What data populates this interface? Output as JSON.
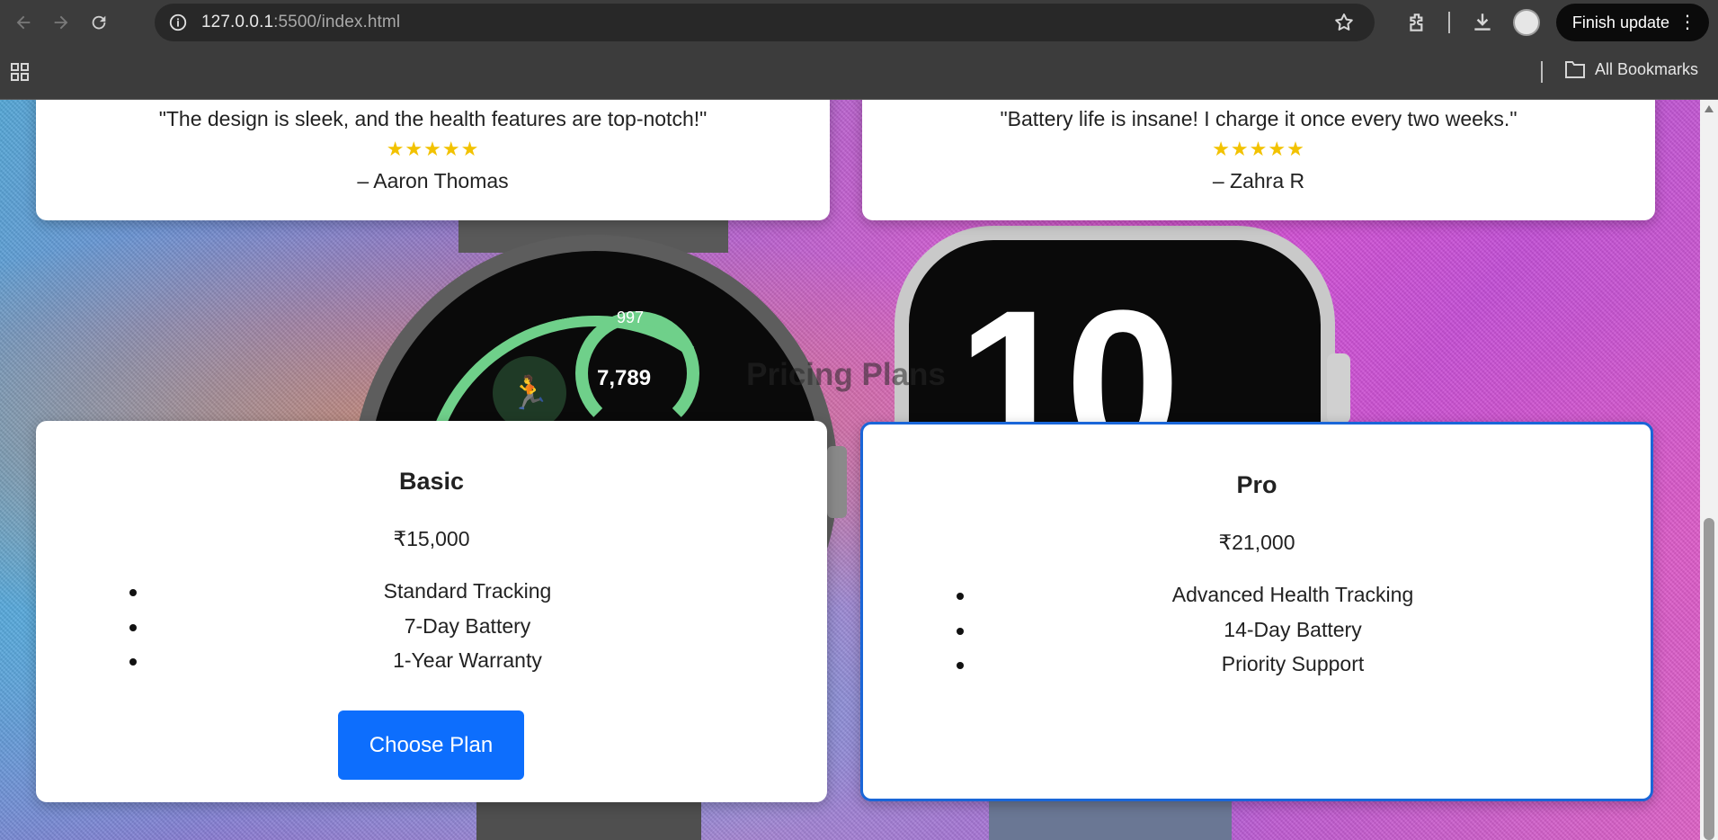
{
  "browser": {
    "url_host": "127.0.0.1",
    "url_path": ":5500/index.html",
    "finish_update": "Finish update",
    "all_bookmarks": "All Bookmarks"
  },
  "testimonials": [
    {
      "quote": "\"The design is sleek, and the health features are top-notch!\"",
      "stars": "★★★★★",
      "rating": 5,
      "author": "– Aaron Thomas"
    },
    {
      "quote": "\"Battery life is insane! I charge it once every two weeks.\"",
      "stars": "★★★★★",
      "rating": 5,
      "author": "– Zahra R"
    }
  ],
  "background": {
    "watch_left_step_count": "7,789",
    "watch_left_small": "997",
    "watch_right_number": "10"
  },
  "pricing": {
    "title": "Pricing Plans",
    "plans": [
      {
        "name": "Basic",
        "price": "₹15,000",
        "features": [
          "Standard Tracking",
          "7-Day Battery",
          "1-Year Warranty"
        ],
        "button": "Choose Plan"
      },
      {
        "name": "Pro",
        "price": "₹21,000",
        "features": [
          "Advanced Health Tracking",
          "14-Day Battery",
          "Priority Support"
        ],
        "highlighted": true
      }
    ]
  },
  "colors": {
    "accent": "#0d6efd",
    "star": "#f2c200",
    "highlight_border": "#1a66d8"
  }
}
